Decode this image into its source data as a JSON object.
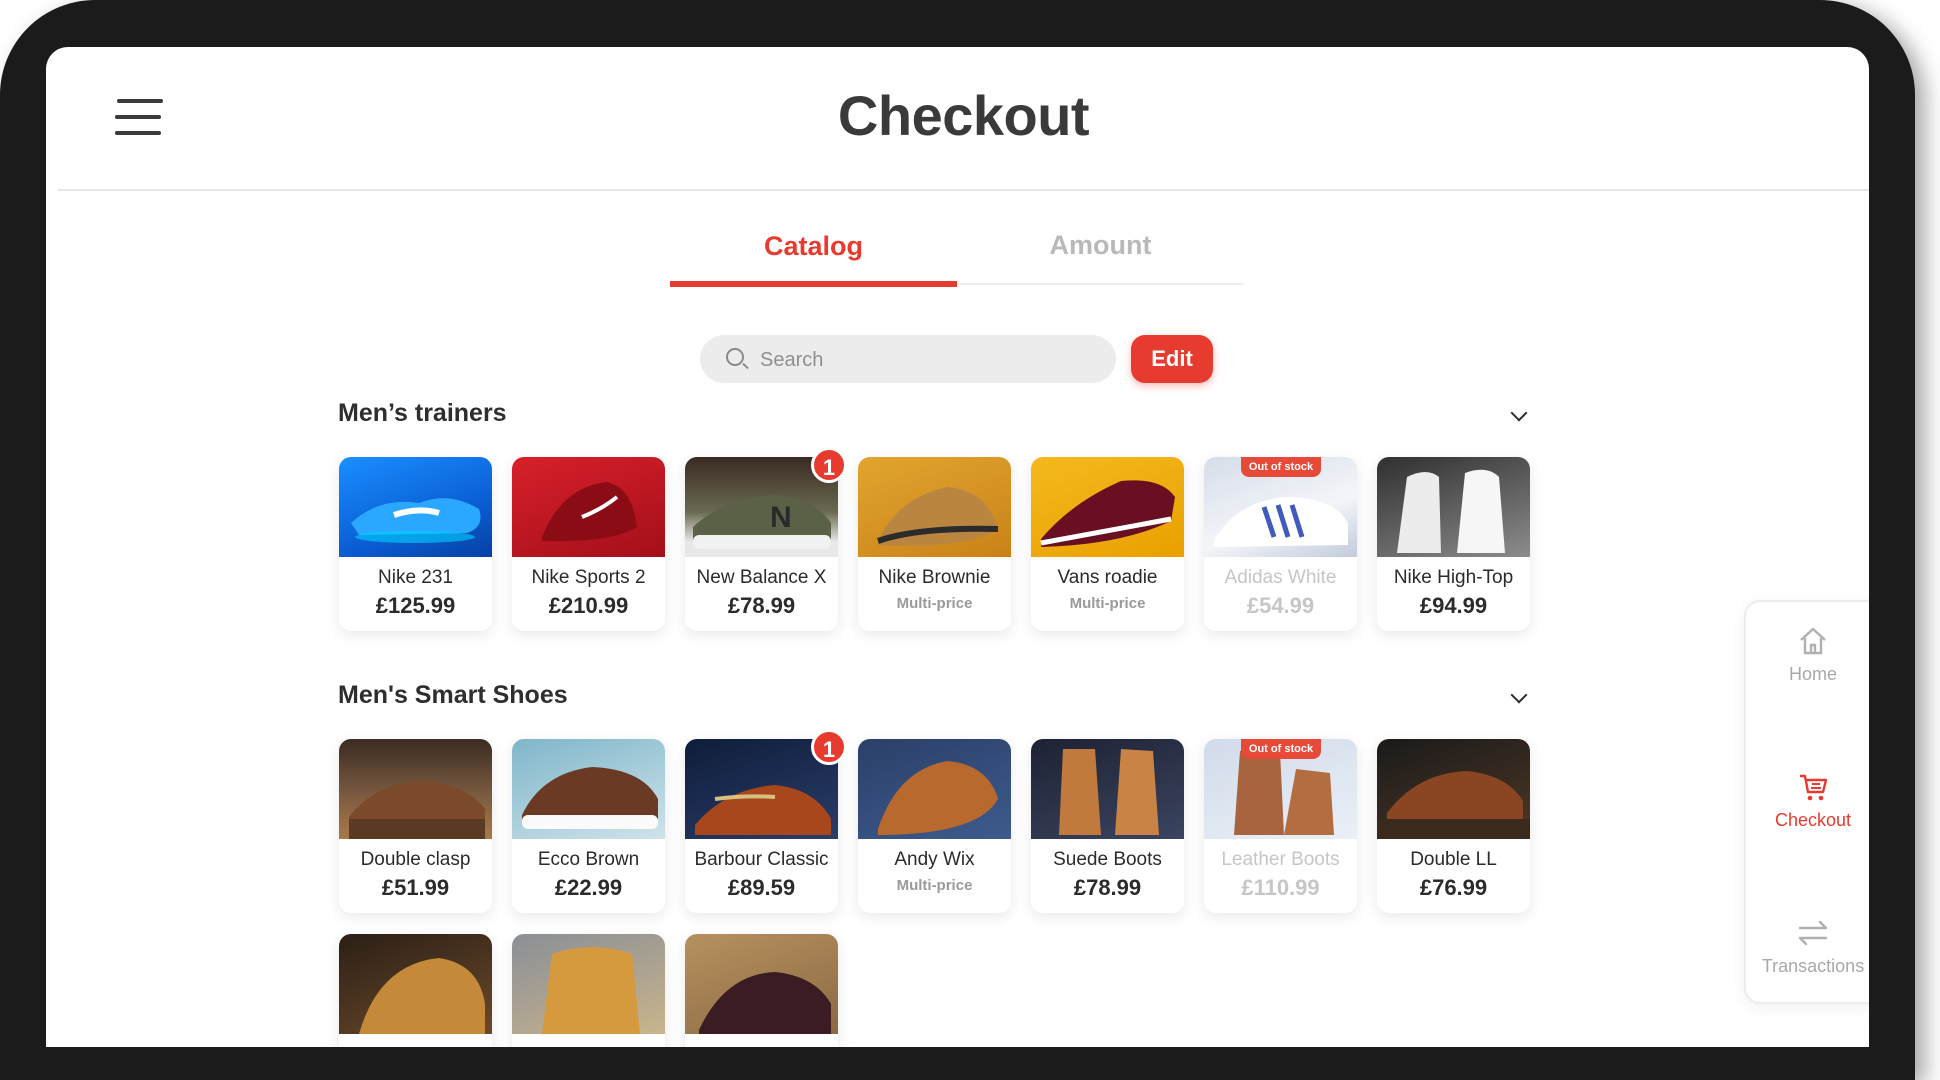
{
  "header": {
    "title": "Checkout"
  },
  "tabs": [
    {
      "label": "Catalog",
      "active": true
    },
    {
      "label": "Amount",
      "active": false
    }
  ],
  "search": {
    "placeholder": "Search",
    "value": ""
  },
  "toolbar": {
    "edit_label": "Edit"
  },
  "colors": {
    "accent": "#e63b2e",
    "muted": "#a8a8a8"
  },
  "sections": [
    {
      "title": "Men’s trainers",
      "items": [
        {
          "name": "Nike 231",
          "price": "£125.99",
          "image": "blue-sneaker"
        },
        {
          "name": "Nike Sports 2",
          "price": "£210.99",
          "image": "red-sneaker"
        },
        {
          "name": "New Balance X",
          "price": "£78.99",
          "badge": "1",
          "image": "olive-sneaker"
        },
        {
          "name": "Nike Brownie",
          "sub": "Multi-price",
          "image": "tan-sneaker"
        },
        {
          "name": "Vans roadie",
          "sub": "Multi-price",
          "image": "maroon-sneaker"
        },
        {
          "name": "Adidas White",
          "price": "£54.99",
          "out_of_stock": "Out of stock",
          "image": "white-blue-sneaker"
        },
        {
          "name": "Nike High-Top",
          "price": "£94.99",
          "image": "white-hightop"
        }
      ]
    },
    {
      "title": "Men's Smart Shoes",
      "items": [
        {
          "name": "Double clasp",
          "price": "£51.99",
          "image": "brown-monk"
        },
        {
          "name": "Ecco Brown",
          "price": "£22.99",
          "image": "brown-sneaker"
        },
        {
          "name": "Barbour Classic",
          "price": "£89.59",
          "badge": "1",
          "image": "brown-loafer"
        },
        {
          "name": "Andy Wix",
          "sub": "Multi-price",
          "image": "tan-brogue"
        },
        {
          "name": "Suede Boots",
          "price": "£78.99",
          "image": "suede-chelsea"
        },
        {
          "name": "Leather Boots",
          "price": "£110.99",
          "out_of_stock": "Out of stock",
          "image": "brogue-boot"
        },
        {
          "name": "Double LL",
          "price": "£76.99",
          "image": "brown-monk-2"
        }
      ]
    },
    {
      "items": [
        {
          "image": "work-boot"
        },
        {
          "image": "suede-hightop"
        },
        {
          "image": "dark-brogue"
        }
      ]
    }
  ],
  "nav": [
    {
      "label": "Home",
      "icon": "home-icon",
      "active": false
    },
    {
      "label": "Checkout",
      "icon": "cart-icon",
      "active": true
    },
    {
      "label": "Transactions",
      "icon": "transfer-icon",
      "active": false
    }
  ]
}
